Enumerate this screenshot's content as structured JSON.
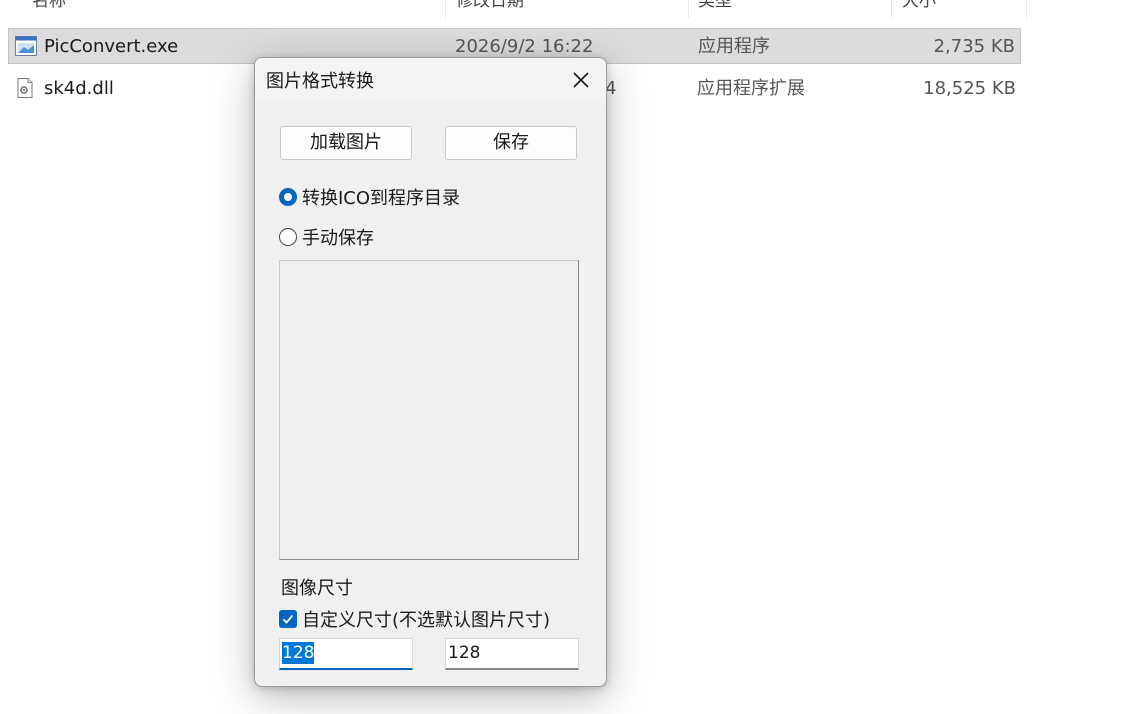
{
  "explorer": {
    "columns": {
      "name": "名称",
      "date": "修改日期",
      "type": "类型",
      "size": "大小"
    },
    "files": [
      {
        "name": "PicConvert.exe",
        "date": "2026/9/2 16:22",
        "type": "应用程序",
        "size": "2,735 KB",
        "icon": "exe-file-icon"
      },
      {
        "name": "sk4d.dll",
        "date": "4",
        "type": "应用程序扩展",
        "size": "18,525 KB",
        "icon": "dll-file-icon"
      }
    ]
  },
  "dialog": {
    "title": "图片格式转换",
    "load_button": "加载图片",
    "save_button": "保存",
    "radio_convert_label": "转换ICO到程序目录",
    "radio_manual_label": "手动保存",
    "size_section_label": "图像尺寸",
    "custom_size_label": "自定义尺寸(不选默认图片尺寸)",
    "width_value": "128",
    "height_value": "128"
  },
  "colors": {
    "accent": "#0067c0",
    "selection_row": "#dcdcdc",
    "dialog_bg": "#f0f0f0"
  }
}
